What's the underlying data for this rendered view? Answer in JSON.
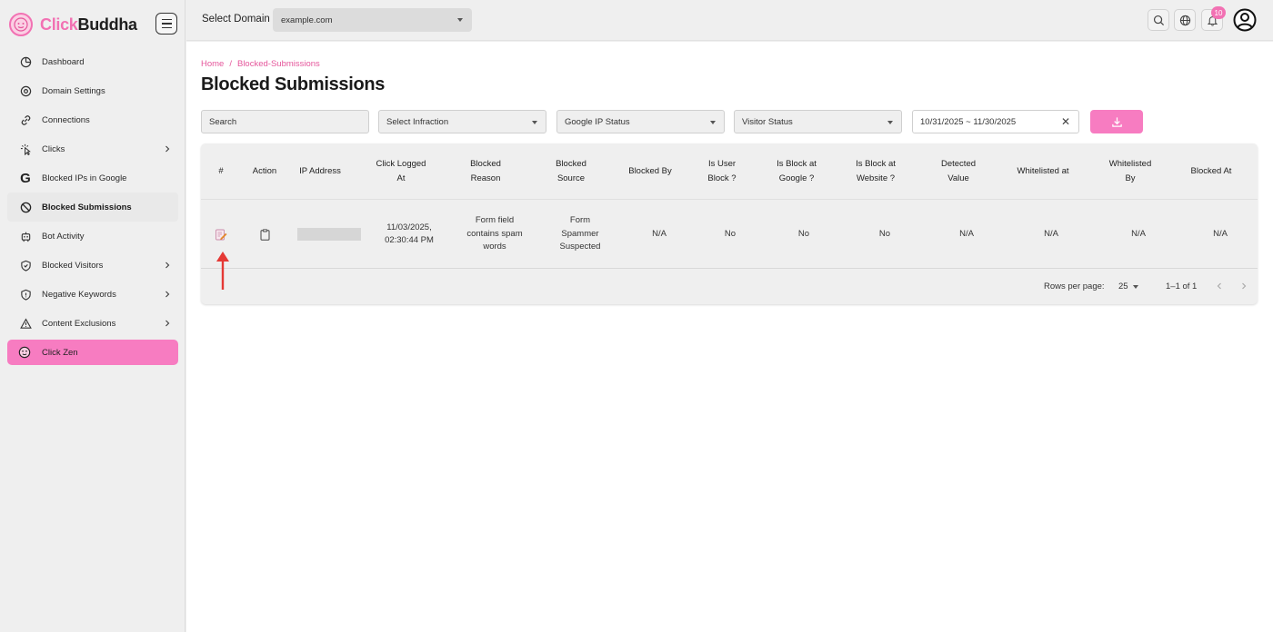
{
  "brand": {
    "part1": "Click",
    "part2": "Buddha"
  },
  "sidebar": {
    "items": [
      {
        "label": "Dashboard",
        "icon": "dashboard-icon"
      },
      {
        "label": "Domain Settings",
        "icon": "settings-icon"
      },
      {
        "label": "Connections",
        "icon": "link-icon"
      },
      {
        "label": "Clicks",
        "icon": "click-icon",
        "expandable": true
      },
      {
        "label": "Blocked IPs in Google",
        "icon": "google-icon"
      },
      {
        "label": "Blocked Submissions",
        "icon": "block-icon",
        "active": true
      },
      {
        "label": "Bot Activity",
        "icon": "bot-icon"
      },
      {
        "label": "Blocked Visitors",
        "icon": "shield-icon",
        "expandable": true
      },
      {
        "label": "Negative Keywords",
        "icon": "shield-minus-icon",
        "expandable": true
      },
      {
        "label": "Content Exclusions",
        "icon": "warning-icon",
        "expandable": true
      },
      {
        "label": "Click Zen",
        "icon": "zen-icon",
        "highlight": "#f77cc1"
      }
    ]
  },
  "topbar": {
    "domain_label": "Select Domain",
    "domain_value": "example.com",
    "notifications_count": "10"
  },
  "breadcrumb": {
    "home": "Home",
    "sep": "/",
    "current": "Blocked-Submissions"
  },
  "page": {
    "title": "Blocked Submissions"
  },
  "filters": {
    "search_placeholder": "Search",
    "infraction": "Select Infraction",
    "google_ip_status": "Google IP Status",
    "visitor_status": "Visitor Status",
    "date_range": "10/31/2025 ~ 11/30/2025"
  },
  "table": {
    "headers": [
      "#",
      "Action",
      "IP Address",
      "Click Logged At",
      "Blocked Reason",
      "Blocked Source",
      "Blocked By",
      "Is User Block ?",
      "Is Block at Google ?",
      "Is Block at Website ?",
      "Detected Value",
      "Whitelisted at",
      "Whitelisted By",
      "Blocked At"
    ],
    "rows": [
      {
        "click_logged_at": "11/03/2025, 02:30:44 PM",
        "blocked_reason": "Form field contains spam words",
        "blocked_source": "Form Spammer Suspected",
        "blocked_by": "N/A",
        "is_user_block": "No",
        "is_block_google": "No",
        "is_block_website": "No",
        "detected_value": "N/A",
        "whitelisted_at": "N/A",
        "whitelisted_by": "N/A",
        "blocked_at": "N/A"
      }
    ],
    "footer": {
      "rows_per_page_label": "Rows per page:",
      "rows_per_page": "25",
      "range": "1–1 of 1"
    }
  },
  "colors": {
    "accent": "#f77cc1",
    "brand_pink": "#f271b3",
    "annotation_red": "#e53935"
  }
}
